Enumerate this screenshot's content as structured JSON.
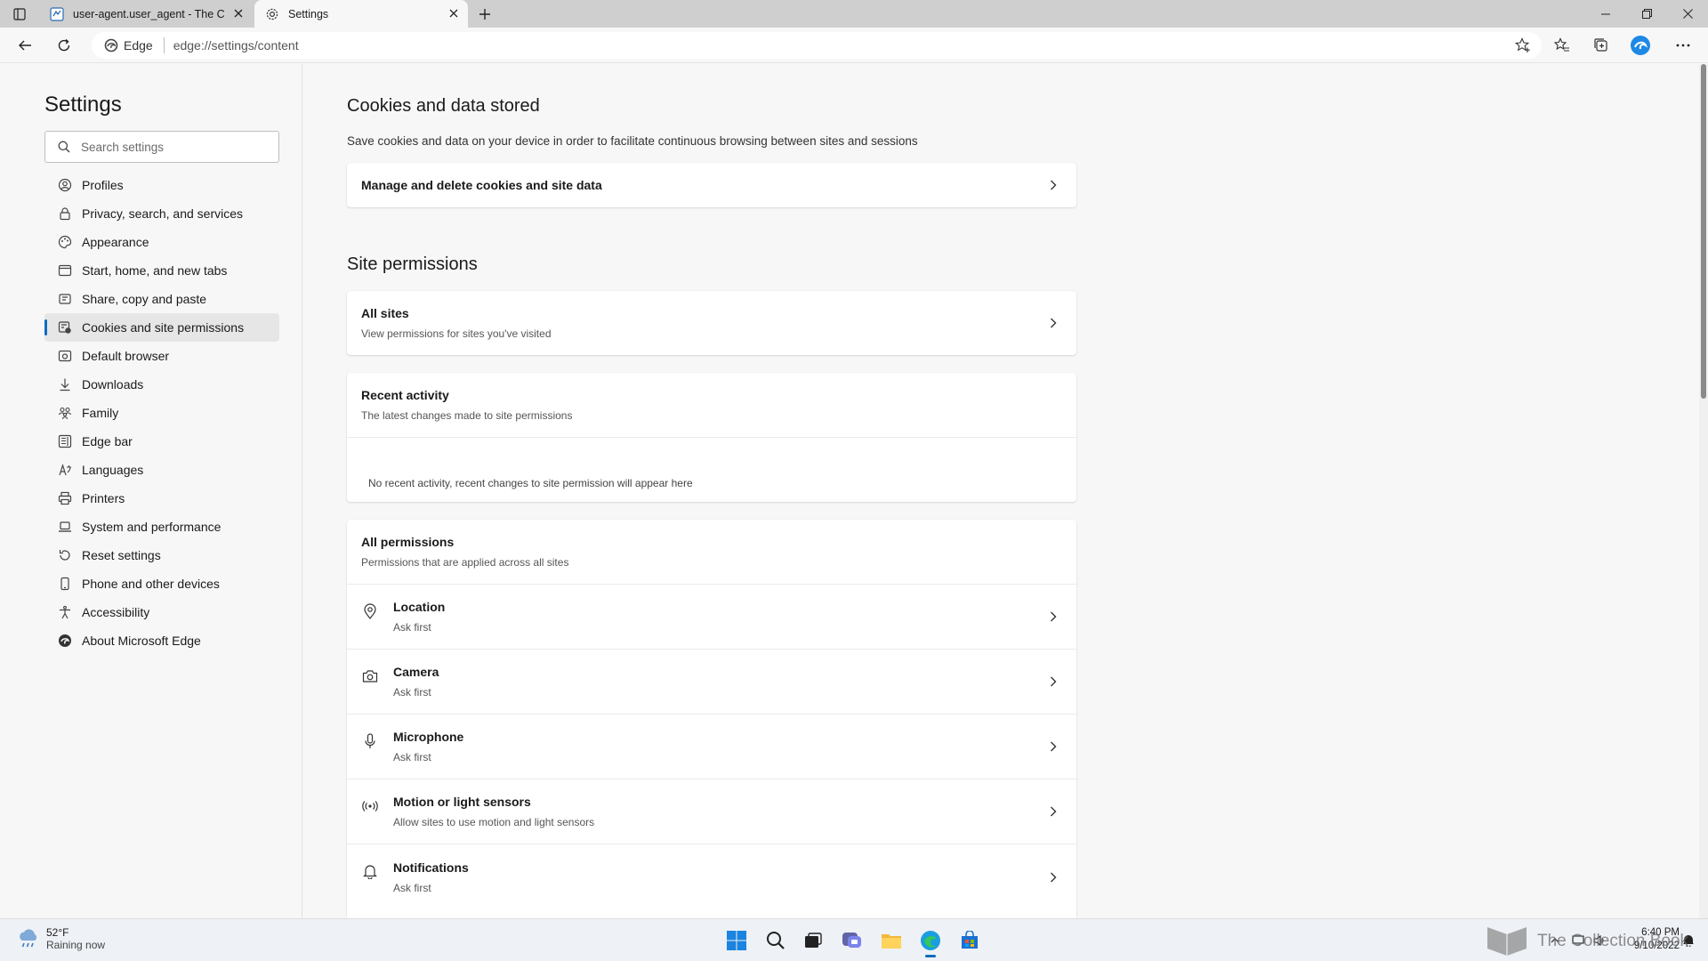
{
  "tabs": [
    {
      "label": "user-agent.user_agent - The Colt",
      "favicon": "page-icon"
    },
    {
      "label": "Settings",
      "favicon": "gear-icon"
    }
  ],
  "address_bar": {
    "site": "Edge",
    "url": "edge://settings/content"
  },
  "sidebar": {
    "title": "Settings",
    "search_placeholder": "Search settings",
    "items": [
      {
        "label": "Profiles",
        "icon": "profile-icon"
      },
      {
        "label": "Privacy, search, and services",
        "icon": "lock-icon"
      },
      {
        "label": "Appearance",
        "icon": "palette-icon"
      },
      {
        "label": "Start, home, and new tabs",
        "icon": "home-window-icon"
      },
      {
        "label": "Share, copy and paste",
        "icon": "share-icon"
      },
      {
        "label": "Cookies and site permissions",
        "icon": "cookie-permissions-icon",
        "active": true
      },
      {
        "label": "Default browser",
        "icon": "browser-icon"
      },
      {
        "label": "Downloads",
        "icon": "download-icon"
      },
      {
        "label": "Family",
        "icon": "family-icon"
      },
      {
        "label": "Edge bar",
        "icon": "edge-bar-icon"
      },
      {
        "label": "Languages",
        "icon": "language-icon"
      },
      {
        "label": "Printers",
        "icon": "printer-icon"
      },
      {
        "label": "System and performance",
        "icon": "laptop-icon"
      },
      {
        "label": "Reset settings",
        "icon": "reset-icon"
      },
      {
        "label": "Phone and other devices",
        "icon": "phone-icon"
      },
      {
        "label": "Accessibility",
        "icon": "accessibility-icon"
      },
      {
        "label": "About Microsoft Edge",
        "icon": "edge-logo-icon"
      }
    ]
  },
  "cookies_section": {
    "title": "Cookies and data stored",
    "description": "Save cookies and data on your device in order to facilitate continuous browsing between sites and sessions",
    "manage_label": "Manage and delete cookies and site data"
  },
  "site_permissions": {
    "title": "Site permissions",
    "all_sites": {
      "title": "All sites",
      "subtitle": "View permissions for sites you've visited"
    },
    "recent_activity": {
      "title": "Recent activity",
      "subtitle": "The latest changes made to site permissions",
      "empty_message": "No recent activity, recent changes to site permission will appear here"
    },
    "all_permissions": {
      "title": "All permissions",
      "subtitle": "Permissions that are applied across all sites",
      "items": [
        {
          "title": "Location",
          "status": "Ask first",
          "icon": "location-icon"
        },
        {
          "title": "Camera",
          "status": "Ask first",
          "icon": "camera-icon"
        },
        {
          "title": "Microphone",
          "status": "Ask first",
          "icon": "microphone-icon"
        },
        {
          "title": "Motion or light sensors",
          "status": "Allow sites to use motion and light sensors",
          "icon": "sensor-icon"
        },
        {
          "title": "Notifications",
          "status": "Ask first",
          "icon": "bell-icon"
        }
      ]
    }
  },
  "taskbar": {
    "weather": {
      "temp": "52°F",
      "condition": "Raining now"
    },
    "clock": {
      "time": "6:40 PM",
      "date": "9/10/2022"
    },
    "watermark": "The Collection Book"
  },
  "colors": {
    "accent": "#0f6cbd",
    "page_bg": "#f7f7f7",
    "card_bg": "#ffffff"
  }
}
